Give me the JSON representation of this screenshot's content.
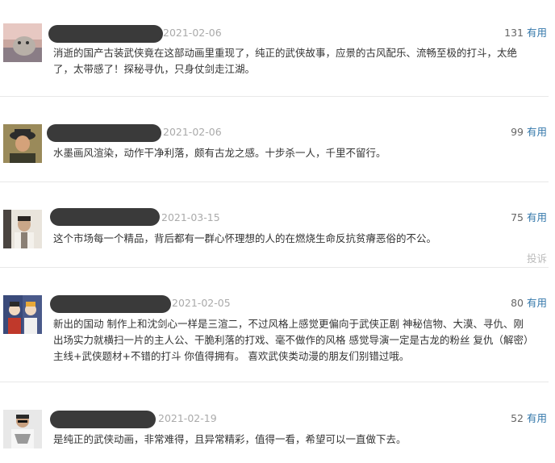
{
  "comments": [
    {
      "date": "2021-02-06",
      "votes": "131",
      "useful_label": "有用",
      "text_lines": [
        "消逝的国产古装武侠竟在这部动画里重现了，纯正的武侠故事，应景的古风配乐、流畅至极的打斗，太绝",
        "了，太带感了！探秘寻仇，只身仗剑走江湖。"
      ]
    },
    {
      "date": "2021-02-06",
      "votes": "99",
      "useful_label": "有用",
      "text_lines": [
        "水墨画风渲染，动作干净利落，颇有古龙之感。十步杀一人，千里不留行。"
      ]
    },
    {
      "date": "2021-03-15",
      "votes": "75",
      "useful_label": "有用",
      "report_label": "投诉",
      "text_lines": [
        "这个市场每一个精品，背后都有一群心怀理想的人的在燃烧生命反抗贫瘠恶俗的不公。"
      ]
    },
    {
      "date": "2021-02-05",
      "votes": "80",
      "useful_label": "有用",
      "text_lines": [
        "新出的国动 制作上和沈剑心一样是三渲二，不过风格上感觉更偏向于武侠正剧 神秘信物、大漠、寻仇、刚",
        "出场实力就横扫一片的主人公、干脆利落的打戏、毫不做作的风格 感觉导演一定是古龙的粉丝 复仇（解密）",
        "主线+武侠题材+不错的打斗 你值得拥有。 喜欢武侠类动漫的朋友们别错过哦。"
      ]
    },
    {
      "date": "2021-02-19",
      "votes": "52",
      "useful_label": "有用",
      "text_lines": [
        "是纯正的武侠动画，非常难得，且异常精彩，值得一看，希望可以一直做下去。"
      ]
    }
  ]
}
